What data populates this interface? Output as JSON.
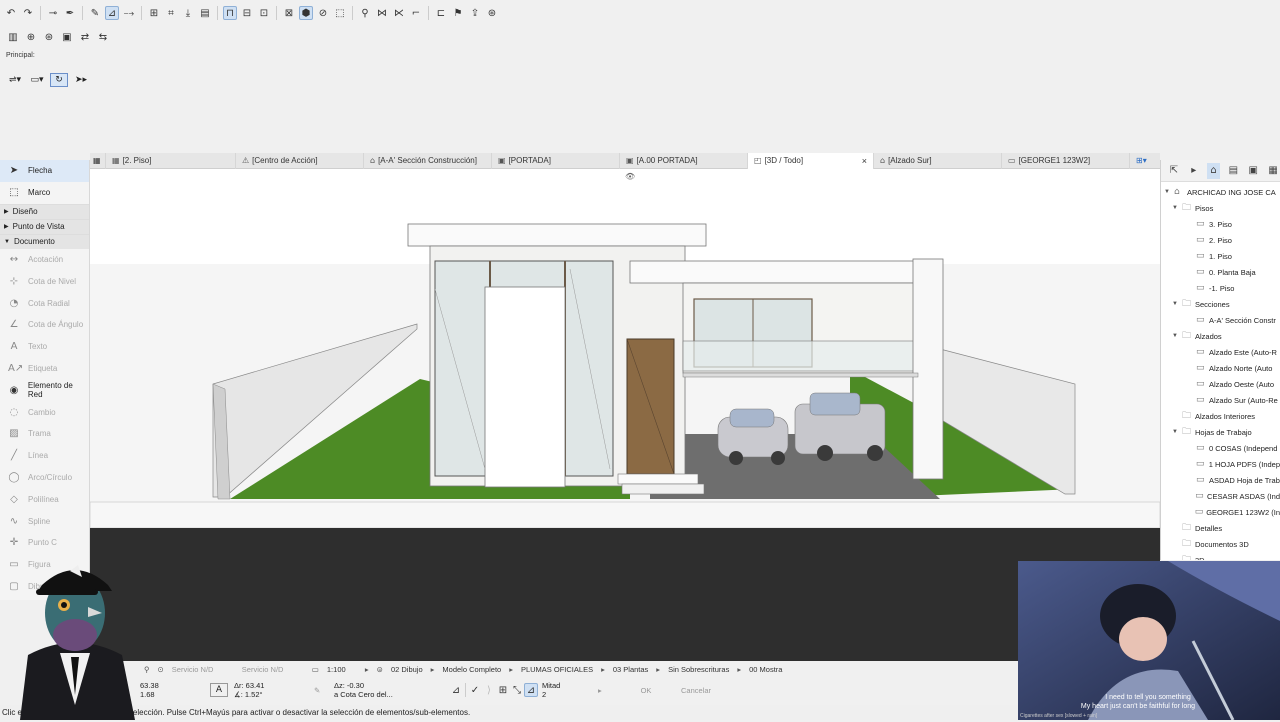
{
  "toolbar": {
    "row1_icons": [
      "undo-icon",
      "redo-icon",
      "pick-up-icon",
      "inject-icon",
      "eyedropper-icon",
      "snap-guides-icon",
      "guide-lines-icon",
      "grid-snap-icon",
      "ruler-icon",
      "gravity-icon",
      "layer-icon",
      "lock-icon",
      "suspend-groups-icon",
      "trace-icon",
      "renovation-icon",
      "3d-view-mode-icon",
      "cutting-plane-icon",
      "marquee-icon",
      "magic-wand-icon",
      "split-icon",
      "adjust-icon",
      "intersect-icon",
      "offset-icon",
      "flag-icon",
      "publish-icon",
      "teamwork-icon"
    ],
    "row2_icons": [
      "wall-tool-icon",
      "settings-icon",
      "favorites-icon",
      "layout-icon",
      "element-transfer-icon",
      "transfer-icon"
    ]
  },
  "info_box": {
    "label": "Principal:"
  },
  "toolbox": {
    "arrow_label": "Flecha",
    "marquee_label": "Marco",
    "sections": [
      "Diseño",
      "Punto de Vista",
      "Documento"
    ],
    "document_tools": [
      {
        "label": "Acotación",
        "icon": "dimension-icon"
      },
      {
        "label": "Cota de Nivel",
        "icon": "level-dimension-icon"
      },
      {
        "label": "Cota Radial",
        "icon": "radial-dimension-icon"
      },
      {
        "label": "Cota de Ángulo",
        "icon": "angle-dimension-icon"
      },
      {
        "label": "Texto",
        "icon": "text-icon"
      },
      {
        "label": "Etiqueta",
        "icon": "label-icon"
      },
      {
        "label": "Elemento de Red",
        "icon": "grid-element-icon"
      },
      {
        "label": "Cambio",
        "icon": "change-icon"
      },
      {
        "label": "Trama",
        "icon": "fill-icon"
      },
      {
        "label": "Línea",
        "icon": "line-icon"
      },
      {
        "label": "Arco/Círculo",
        "icon": "arc-icon"
      },
      {
        "label": "Polilínea",
        "icon": "polyline-icon"
      },
      {
        "label": "Spline",
        "icon": "spline-icon"
      },
      {
        "label": "Punto C",
        "icon": "hotspot-icon"
      },
      {
        "label": "Figura",
        "icon": "figure-icon"
      },
      {
        "label": "Dibujo",
        "icon": "drawing-icon"
      }
    ]
  },
  "tabs": [
    {
      "label": "[2. Piso]",
      "icon": "floor-plan-icon"
    },
    {
      "label": "[Centro de Acción]",
      "icon": "action-center-icon"
    },
    {
      "label": "[A-A' Sección Construcción]",
      "icon": "section-icon"
    },
    {
      "label": "[PORTADA]",
      "icon": "layout-icon"
    },
    {
      "label": "[A.00 PORTADA]",
      "icon": "layout-icon"
    },
    {
      "label": "[3D / Todo]",
      "icon": "3d-icon"
    },
    {
      "label": "[Alzado Sur]",
      "icon": "elevation-icon"
    },
    {
      "label": "[GEORGE1 123W2]",
      "icon": "worksheet-icon"
    }
  ],
  "navigator": {
    "root": "ARCHICAD ING JOSE CA",
    "pisos_label": "Pisos",
    "pisos": [
      "3. Piso",
      "2. Piso",
      "1. Piso",
      "0. Planta Baja",
      "-1. Piso"
    ],
    "secciones_label": "Secciones",
    "secciones": [
      "A-A' Sección Constr"
    ],
    "alzados_label": "Alzados",
    "alzados": [
      "Alzado Este (Auto-R",
      "Alzado Norte (Auto",
      "Alzado Oeste (Auto",
      "Alzado Sur (Auto-Re"
    ],
    "alzados_interiores": "Alzados Interiores",
    "hojas_label": "Hojas de Trabajo",
    "hojas": [
      "0 COSAS (Independ",
      "1 HOJA PDFS (Indep",
      "ASDAD Hoja de Trab",
      "CESASR ASDAS (Ind",
      "GEORGE1 123W2 (In"
    ],
    "detalles": "Detalles",
    "documentos3d": "Documentos 3D",
    "tresd": "3D"
  },
  "infobar": {
    "servicio1": "Servicio N/D",
    "servicio2": "Servicio N/D",
    "scale": "1:100",
    "dibujo": "02 Dibujo",
    "modelo": "Modelo Completo",
    "plumas": "PLUMAS OFICIALES",
    "plantas": "03 Plantas",
    "sobrescrituras": "Sin Sobrescrituras",
    "mostrar": "00 Mostra"
  },
  "coords": {
    "x": "63.38",
    "y": "1.68",
    "dr": "Δr: 63.41",
    "angle": "∡: 1.52°",
    "dz": "Δz: -0.30",
    "ref": "a Cota Cero del...",
    "mitad": "Mitad",
    "mitad_n": "2",
    "ok": "OK",
    "cancel": "Cancelar"
  },
  "status": {
    "prefix": "Clic en",
    "text": "de Selección. Pulse Ctrl+Mayús para activar o desactivar la selección de elementos/sub-elementos."
  },
  "video": {
    "subtitle1": "I need to tell you something",
    "subtitle2": "My heart just can't be faithful for long",
    "caption": "Cigarettes after sex [slowed + rain]"
  },
  "colors": {
    "accent": "#2b6cc4",
    "grass": "#4a8a22",
    "wall": "#f4f4f2",
    "ground": "#2d2d2d",
    "door": "#8b6a44"
  }
}
